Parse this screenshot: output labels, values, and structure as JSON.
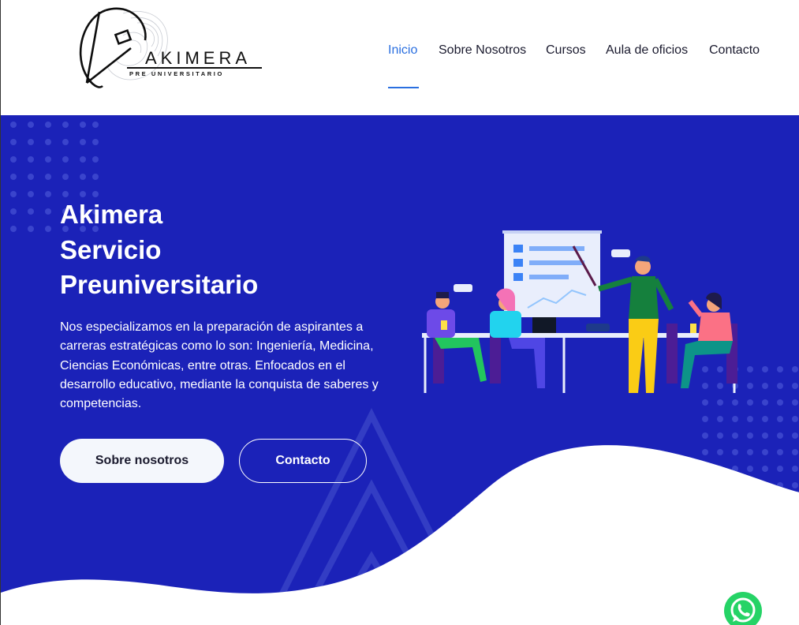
{
  "brand": {
    "name": "AKIMERA",
    "tagline": "PRE UNIVERSITARIO"
  },
  "nav": {
    "items": [
      {
        "label": "Inicio",
        "active": true
      },
      {
        "label": "Sobre Nosotros",
        "active": false
      },
      {
        "label": "Cursos",
        "active": false
      },
      {
        "label": "Aula de oficios",
        "active": false
      },
      {
        "label": "Contacto",
        "active": false
      }
    ]
  },
  "hero": {
    "title_lines": [
      "Akimera",
      "Servicio",
      "Preuniversitario"
    ],
    "description": "Nos especializamos en la preparación de aspirantes a carreras estratégicas como lo son: Ingeniería, Medicina, Ciencias Económicas, entre otras. Enfocados en el desarrollo educativo, mediante la conquista de saberes y competencias.",
    "primary_button": "Sobre nosotros",
    "secondary_button": "Contacto"
  },
  "colors": {
    "hero_bg": "#1b22b8",
    "accent": "#2a6fe0",
    "whatsapp": "#25d366"
  },
  "icons": {
    "floating": "whatsapp-icon",
    "illustration": "team-meeting-illustration"
  }
}
